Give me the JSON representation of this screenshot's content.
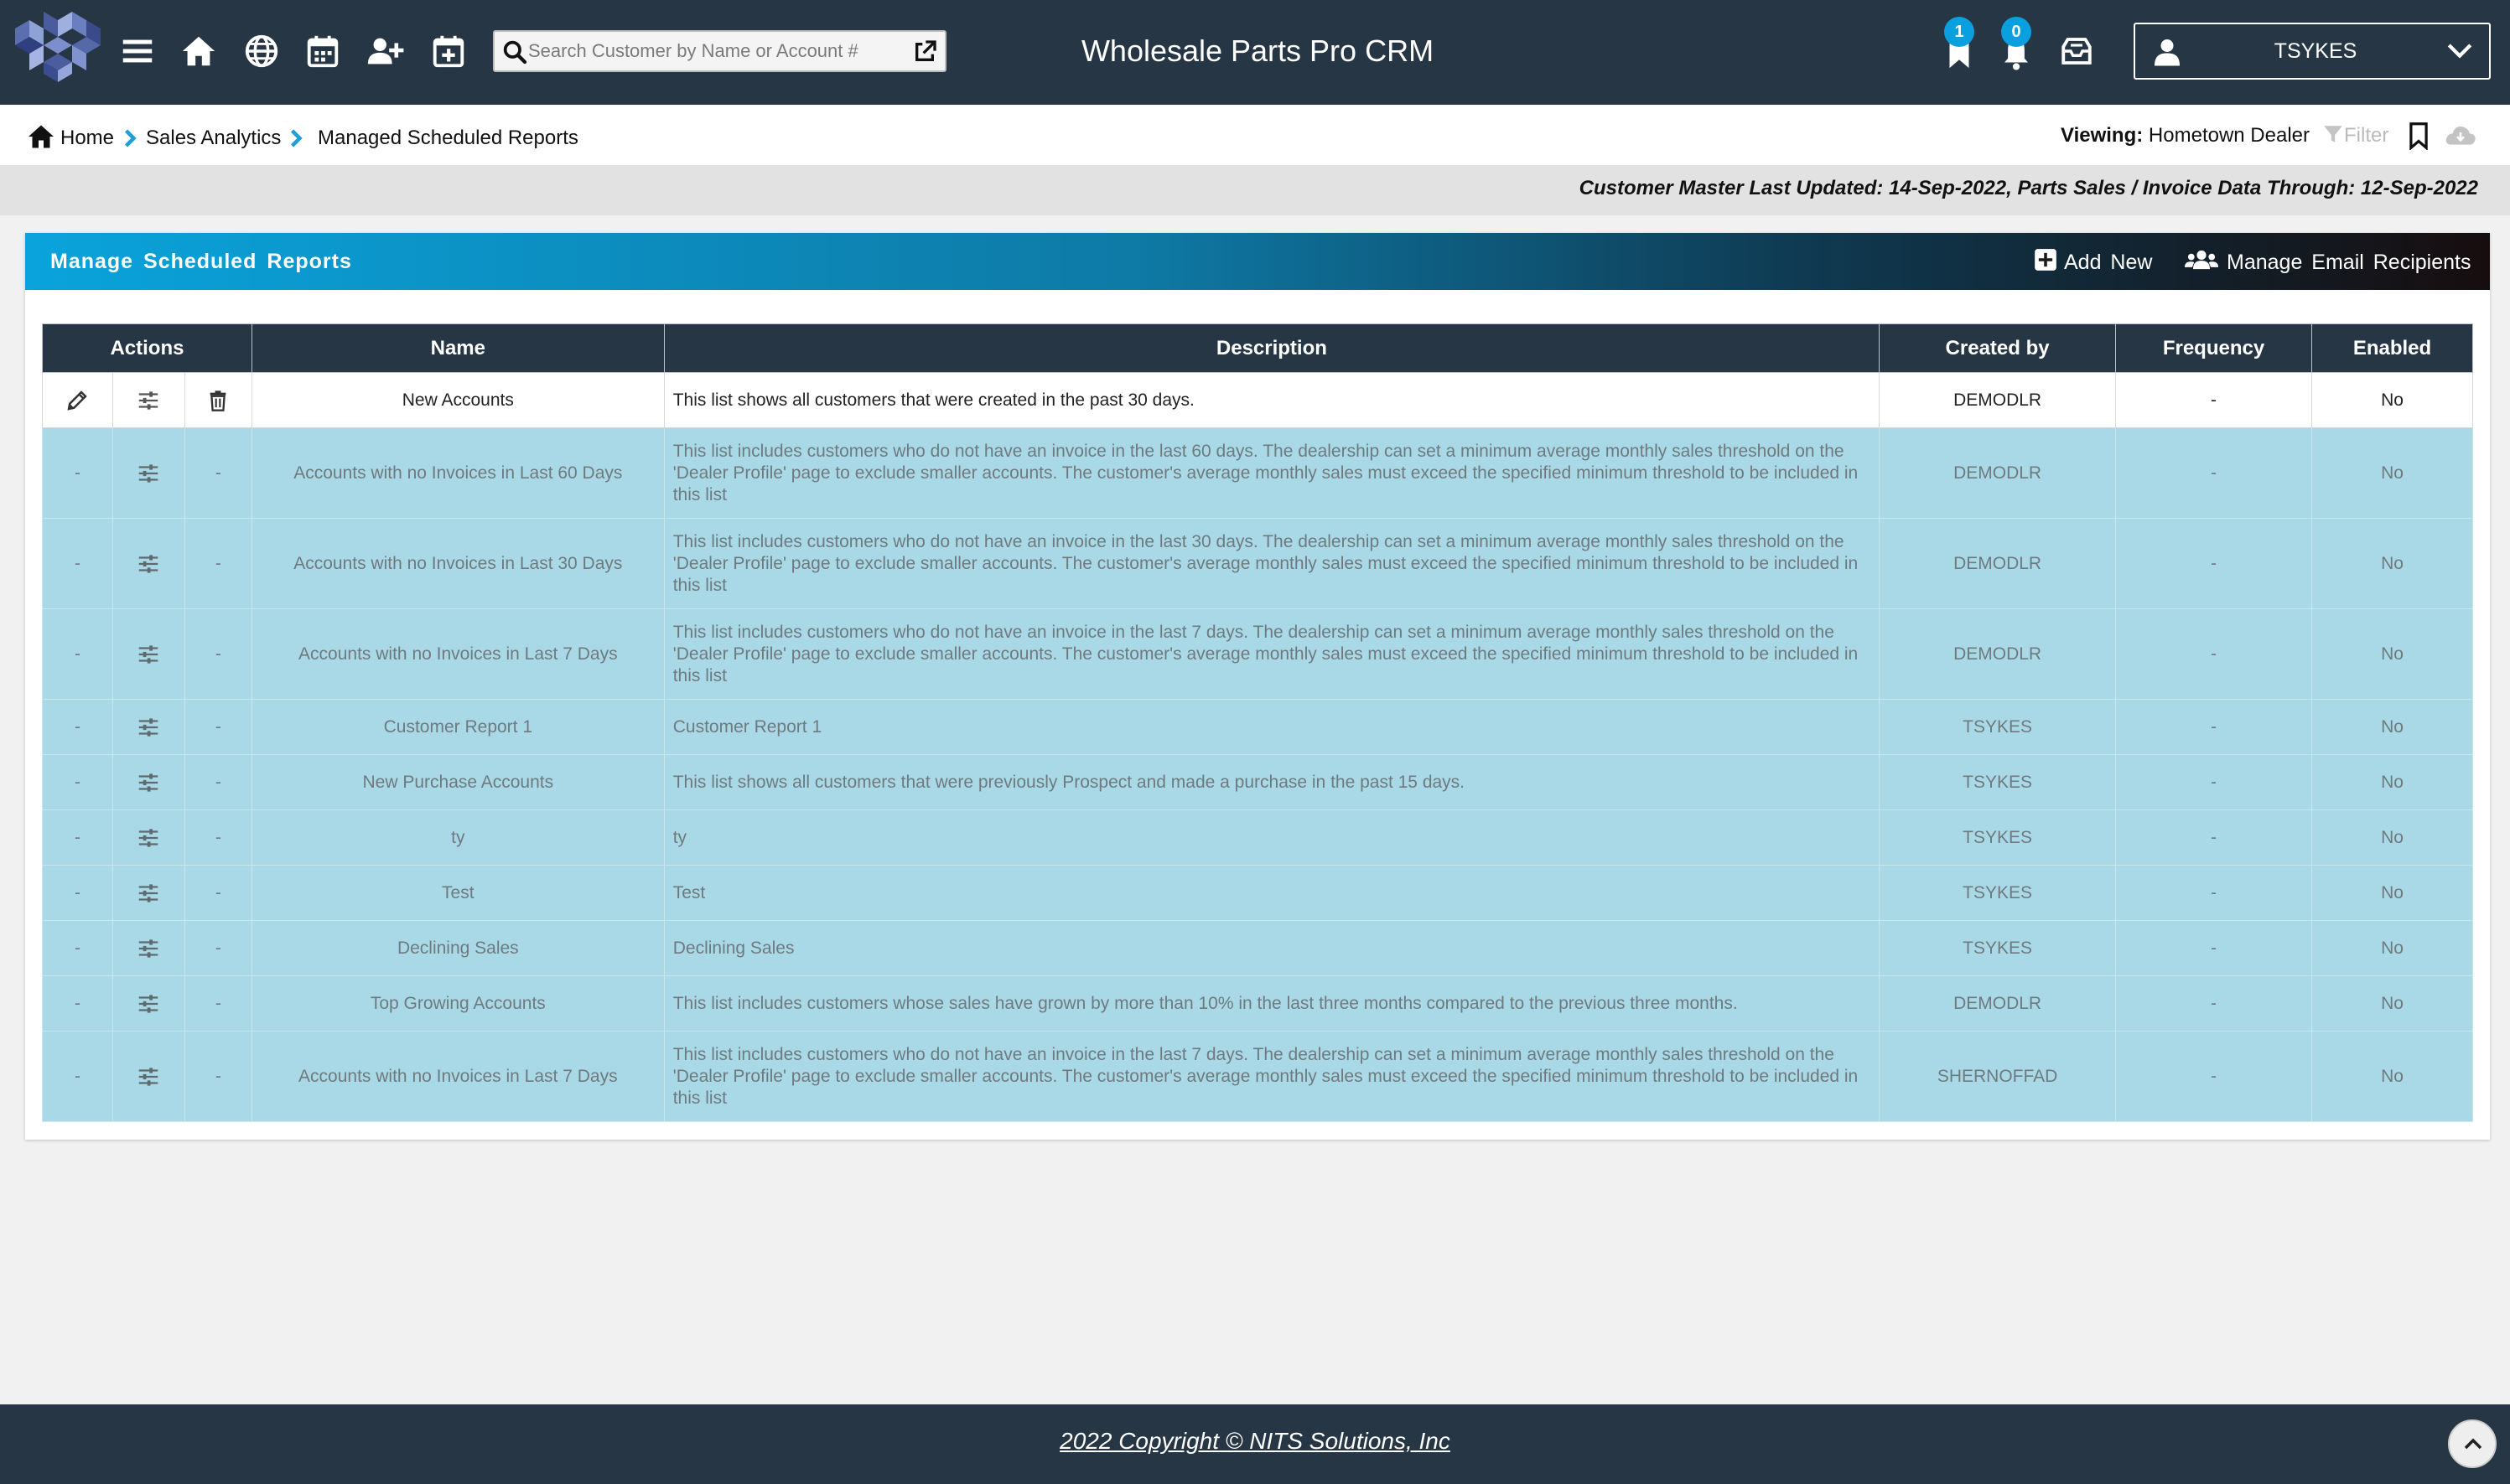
{
  "header": {
    "app_title": "Wholesale Parts Pro CRM",
    "search_placeholder": "Search Customer by Name or Account #",
    "bookmark_count": "1",
    "notification_count": "0",
    "user_name": "TSYKES",
    "icons": [
      "logo",
      "menu-icon",
      "home-icon",
      "globe-icon",
      "calendar-icon",
      "add-user-icon",
      "calendar-plus-icon",
      "search-icon",
      "external-link-icon",
      "bookmark-icon",
      "bell-icon",
      "inbox-icon",
      "user-icon",
      "chevron-down-icon"
    ]
  },
  "breadcrumb": {
    "items": [
      "Home",
      "Sales Analytics",
      "Managed Scheduled Reports"
    ],
    "viewing_label": "Viewing:",
    "viewing_value": "Hometown Dealer",
    "filter_label": "Filter"
  },
  "update_banner": "Customer Master Last Updated: 14-Sep-2022, Parts Sales / Invoice Data Through: 12-Sep-2022",
  "panel": {
    "title": "Manage Scheduled Reports",
    "add_new_label": "Add New",
    "manage_recipients_label": "Manage Email Recipients"
  },
  "table": {
    "headers": [
      "Actions",
      "Name",
      "Description",
      "Created by",
      "Frequency",
      "Enabled"
    ],
    "rows": [
      {
        "name": "New Accounts",
        "description": "This list shows all customers that were created in the past 30 days.",
        "created_by": "DEMODLR",
        "frequency": "-",
        "enabled": "No",
        "edit": true
      },
      {
        "name": "Accounts with no Invoices in Last 60 Days",
        "description": "This list includes customers who do not have an invoice in the last 60 days. The dealership can set a minimum average monthly sales threshold on the 'Dealer Profile' page to exclude smaller accounts. The customer's average monthly sales must exceed the specified minimum threshold to be included in this list",
        "created_by": "DEMODLR",
        "frequency": "-",
        "enabled": "No",
        "edit": false
      },
      {
        "name": "Accounts with no Invoices in Last 30 Days",
        "description": "This list includes customers who do not have an invoice in the last 30 days. The dealership can set a minimum average monthly sales threshold on the 'Dealer Profile' page to exclude smaller accounts. The customer's average monthly sales must exceed the specified minimum threshold to be included in this list",
        "created_by": "DEMODLR",
        "frequency": "-",
        "enabled": "No",
        "edit": false
      },
      {
        "name": "Accounts with no Invoices in Last 7 Days",
        "description": "This list includes customers who do not have an invoice in the last 7 days. The dealership can set a minimum average monthly sales threshold on the 'Dealer Profile' page to exclude smaller accounts. The customer's average monthly sales must exceed the specified minimum threshold to be included in this list",
        "created_by": "DEMODLR",
        "frequency": "-",
        "enabled": "No",
        "edit": false
      },
      {
        "name": "Customer Report 1",
        "description": "Customer Report 1",
        "created_by": "TSYKES",
        "frequency": "-",
        "enabled": "No",
        "edit": false
      },
      {
        "name": "New Purchase Accounts",
        "description": "This list shows all customers that were previously Prospect and made a purchase in the past 15 days.",
        "created_by": "TSYKES",
        "frequency": "-",
        "enabled": "No",
        "edit": false
      },
      {
        "name": "ty",
        "description": "ty",
        "created_by": "TSYKES",
        "frequency": "-",
        "enabled": "No",
        "edit": false
      },
      {
        "name": "Test",
        "description": "Test",
        "created_by": "TSYKES",
        "frequency": "-",
        "enabled": "No",
        "edit": false
      },
      {
        "name": "Declining Sales",
        "description": "Declining Sales",
        "created_by": "TSYKES",
        "frequency": "-",
        "enabled": "No",
        "edit": false
      },
      {
        "name": "Top Growing Accounts",
        "description": "This list includes customers whose sales have grown by more than 10% in the last three months compared to the previous three months.",
        "created_by": "DEMODLR",
        "frequency": "-",
        "enabled": "No",
        "edit": false
      },
      {
        "name": "Accounts with no Invoices in Last 7 Days",
        "description": "This list includes customers who do not have an invoice in the last 7 days. The dealership can set a minimum average monthly sales threshold on the 'Dealer Profile' page to exclude smaller accounts. The customer's average monthly sales must exceed the specified minimum threshold to be included in this list",
        "created_by": "SHERNOFFAD",
        "frequency": "-",
        "enabled": "No",
        "edit": false
      }
    ],
    "placeholder_action": "-"
  },
  "footer": {
    "copyright": "2022 Copyright © NITS Solutions, Inc"
  },
  "colors": {
    "topbar": "#263645",
    "accent": "#0aa3db",
    "row_bg": "#a9d9e6",
    "badge": "#0aa0e0"
  }
}
